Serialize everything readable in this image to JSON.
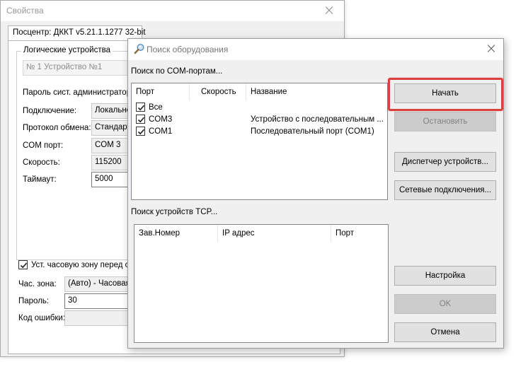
{
  "back_window": {
    "title": "Свойства",
    "tab_label": "Посцентр: ДККТ v5.21.1.1277 32-bit",
    "group_title": "Логические устройства",
    "device_select": "№ 1 Устройство №1",
    "fields": {
      "admin_password_label": "Пароль сист. администратора",
      "connection_label": "Подключение:",
      "connection_value": "Локально",
      "protocol_label": "Протокол обмена:",
      "protocol_value": "Стандарт",
      "com_port_label": "COM порт:",
      "com_port_value": "COM 3",
      "speed_label": "Скорость:",
      "speed_value": "115200",
      "timeout_label": "Таймаут:",
      "timeout_value": "5000"
    },
    "timezone_checkbox_label": "Уст. часовую зону перед от",
    "timezone_label": "Час. зона:",
    "timezone_value": "(Авто) - Часовая",
    "password_label": "Пароль:",
    "password_value": "30",
    "error_code_label": "Код ошибки:",
    "error_code_value": ""
  },
  "dialog": {
    "title": "Поиск оборудования",
    "com_section_label": "Поиск по COM-портам...",
    "com_columns": [
      "Порт",
      "Скорость",
      "Название"
    ],
    "com_rows": [
      {
        "port": "Все",
        "speed": "",
        "name": "",
        "checked": true
      },
      {
        "port": "COM3",
        "speed": "",
        "name": "Устройство с последовательным ...",
        "checked": true
      },
      {
        "port": "COM1",
        "speed": "",
        "name": "Последовательный порт (COM1)",
        "checked": true
      }
    ],
    "tcp_section_label": "Поиск устройств TCP...",
    "tcp_columns": [
      "Зав.Номер",
      "IP адрес",
      "Порт"
    ],
    "buttons": {
      "start": "Начать",
      "stop": "Остановить",
      "device_manager": "Диспетчер устройств...",
      "network_connections": "Сетевые подключения...",
      "settings": "Настройка",
      "ok": "OK",
      "cancel": "Отмена"
    }
  },
  "colors": {
    "highlight": "#d9413d",
    "button_face": "#e1e1e1",
    "button_disabled": "#cccccc"
  }
}
